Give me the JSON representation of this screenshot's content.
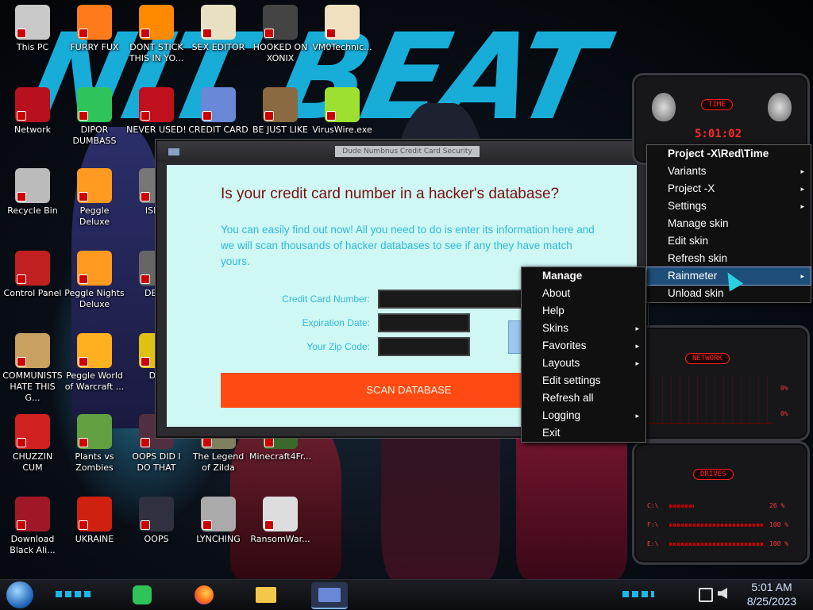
{
  "desktop_icons": [
    {
      "label": "This PC",
      "icon": "monitor-icon"
    },
    {
      "label": "FURRY FUX",
      "icon": "firefox-icon"
    },
    {
      "label": "DONT STICK THIS IN YO...",
      "icon": "vlc-cone-icon"
    },
    {
      "label": "SEX EDITOR",
      "icon": "hxd-editor-icon"
    },
    {
      "label": "HOOKED ON XONIX",
      "icon": "xonix-game-icon"
    },
    {
      "label": "VM0Technic...",
      "icon": "doctor-avatar-icon"
    },
    {
      "label": "Network",
      "icon": "alien-network-icon"
    },
    {
      "label": "DIPOR DUMBASS",
      "icon": "green-chat-icon"
    },
    {
      "label": "NEVER USED!",
      "icon": "dev-plus-icon"
    },
    {
      "label": "CREDIT CARD",
      "icon": "credit-card-icon"
    },
    {
      "label": "BE JUST LIKE",
      "icon": "santa-icon"
    },
    {
      "label": "VirusWire.exe",
      "icon": "lime-icon"
    },
    {
      "label": "Recycle Bin",
      "icon": "recycle-bin-icon"
    },
    {
      "label": "Peggle Deluxe",
      "icon": "peggle-icon"
    },
    {
      "label": "ISRAI",
      "icon": "gear-icon"
    },
    {
      "label": "Control Panel",
      "icon": "control-panel-icon"
    },
    {
      "label": "Peggle Nights Deluxe",
      "icon": "peggle-nights-icon"
    },
    {
      "label": "DEEZ",
      "icon": "printer-icon"
    },
    {
      "label": "COMMUNISTS HATE THIS G...",
      "icon": "money-bag-icon"
    },
    {
      "label": "Peggle World of Warcraft ...",
      "icon": "peggle-wow-icon"
    },
    {
      "label": "DIE",
      "icon": "d-icon"
    },
    {
      "label": "CHUZZIN CUM",
      "icon": "chuzzle-icon"
    },
    {
      "label": "Plants vs Zombies",
      "icon": "plants-icon"
    },
    {
      "label": "OOPS DID I DO THAT",
      "icon": "photo-icon"
    },
    {
      "label": "The Legend of Zilda",
      "icon": "zelda-icon"
    },
    {
      "label": "Minecraft4Fr...",
      "icon": "minecraft-icon"
    },
    {
      "label": "Download Black Ali...",
      "icon": "alien-download-icon"
    },
    {
      "label": "UKRAINE",
      "icon": "radiation-icon"
    },
    {
      "label": "OOPS",
      "icon": "screen-shield-icon"
    },
    {
      "label": "LYNCHING",
      "icon": "noose-icon"
    },
    {
      "label": "RansomWar...",
      "icon": "skull-icon"
    }
  ],
  "window": {
    "title": "Dude Numbnus Credit Card Security",
    "heading": "Is your credit card number in a hacker's database?",
    "description": "You can easily find out now! All you need to do is enter its information here and we will scan thousands of hacker databases to see if any they have match yours.",
    "fields": {
      "card_number_label": "Credit Card Number:",
      "expiration_label": "Expiration Date:",
      "zip_label": "Your Zip Code:"
    },
    "scan_button": "SCAN DATABASE"
  },
  "context_menu_right": {
    "items": [
      {
        "label": "Project -X\\Red\\Time",
        "header": true
      },
      {
        "label": "Variants",
        "submenu": true
      },
      {
        "label": "Project -X",
        "submenu": true
      },
      {
        "label": "Settings",
        "submenu": true
      },
      {
        "label": "Manage skin"
      },
      {
        "label": "Edit skin"
      },
      {
        "label": "Refresh skin"
      },
      {
        "label": "Rainmeter",
        "submenu": true,
        "selected": true
      },
      {
        "label": "Unload skin"
      }
    ]
  },
  "context_menu_left": {
    "items": [
      {
        "label": "Manage",
        "header": true
      },
      {
        "label": "About"
      },
      {
        "label": "Help"
      },
      {
        "label": "Skins",
        "submenu": true
      },
      {
        "label": "Favorites",
        "submenu": true
      },
      {
        "label": "Layouts",
        "submenu": true
      },
      {
        "label": "Edit settings"
      },
      {
        "label": "Refresh all"
      },
      {
        "label": "Logging",
        "submenu": true
      },
      {
        "label": "Exit"
      }
    ]
  },
  "rainmeter": {
    "time_label": "TIME",
    "time_value": "5:01:02",
    "network_label": "NETWORK",
    "network_up": "0%",
    "network_down": "0%",
    "drives_label": "DRIVES",
    "drives": [
      {
        "name": "C:\\",
        "pct": "26 %",
        "fill": 0.26
      },
      {
        "name": "F:\\",
        "pct": "100 %",
        "fill": 1.0
      },
      {
        "name": "E:\\",
        "pct": "100 %",
        "fill": 1.0
      }
    ]
  },
  "taskbar": {
    "time": "5:01 AM",
    "date": "8/25/2023",
    "apps": [
      "green-chat-icon",
      "firefox-icon",
      "file-explorer-icon",
      "credit-card-icon"
    ]
  },
  "wallpaper_text": "NIT BEAT",
  "colors": {
    "accent": "#1bb8e6",
    "heading": "#7a0e0e",
    "scan": "#ff4a14",
    "meter_red": "#ff2020"
  }
}
